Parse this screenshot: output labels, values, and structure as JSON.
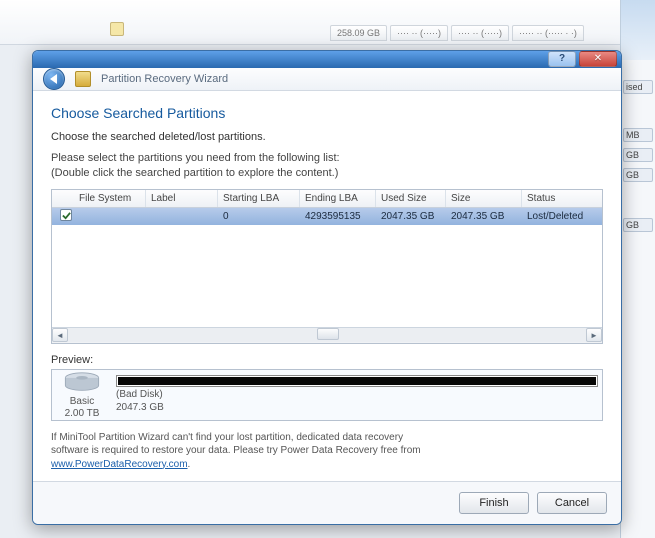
{
  "background": {
    "tabs_behind": [
      "258.09 GB",
      "···· ·· (·····)",
      "···· ·· (·····)",
      "····· ·· (····· · ·)"
    ],
    "right_stubs": [
      "ised",
      "MB",
      "GB",
      "GB",
      "GB"
    ]
  },
  "window": {
    "help_tooltip": "Help",
    "close_tooltip": "Close",
    "header_title": "Partition Recovery Wizard"
  },
  "page": {
    "title": "Choose Searched Partitions",
    "instruction1": "Choose the searched deleted/lost partitions.",
    "instruction2a": "Please select the partitions you need from the following list:",
    "instruction2b": "(Double click the searched partition to explore the content.)"
  },
  "table": {
    "headers": [
      "",
      "File System",
      "Label",
      "Starting LBA",
      "Ending LBA",
      "Used Size",
      "Size",
      "Status"
    ],
    "rows": [
      {
        "checked": true,
        "file_system": "",
        "label": "",
        "starting_lba": "0",
        "ending_lba": "4293595135",
        "used_size": "2047.35 GB",
        "size": "2047.35 GB",
        "status": "Lost/Deleted"
      }
    ]
  },
  "preview": {
    "label": "Preview:",
    "disk_type": "Basic",
    "disk_capacity": "2.00 TB",
    "bar_name": "(Bad Disk)",
    "bar_size": "2047.3 GB"
  },
  "info": {
    "line1": "If MiniTool Partition Wizard can't find your lost partition, dedicated data recovery",
    "line2": "software is required to restore your data. Please try Power Data Recovery free from",
    "link_text": "www.PowerDataRecovery.com",
    "link_period": "."
  },
  "buttons": {
    "finish": "Finish",
    "cancel": "Cancel"
  }
}
